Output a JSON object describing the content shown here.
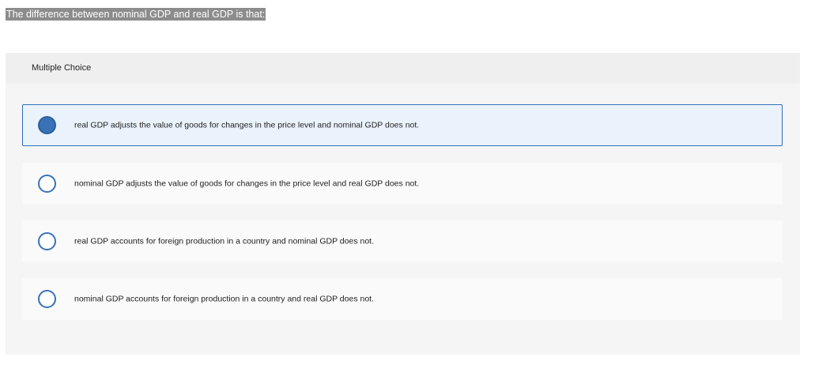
{
  "question": {
    "text": "The difference between nominal GDP and real GDP is that:"
  },
  "panel": {
    "header_label": "Multiple Choice",
    "choices": [
      {
        "label": "real GDP adjusts the value of goods for changes in the price level and nominal GDP does not.",
        "selected": true
      },
      {
        "label": "nominal GDP adjusts the value of goods for changes in the price level and real GDP does not.",
        "selected": false
      },
      {
        "label": "real GDP accounts for foreign production in a country and nominal GDP does not.",
        "selected": false
      },
      {
        "label": "nominal GDP accounts for foreign production in a country and real GDP does not.",
        "selected": false
      }
    ]
  },
  "colors": {
    "accent": "#3a72b8",
    "selected_background": "#eaf3fb"
  }
}
